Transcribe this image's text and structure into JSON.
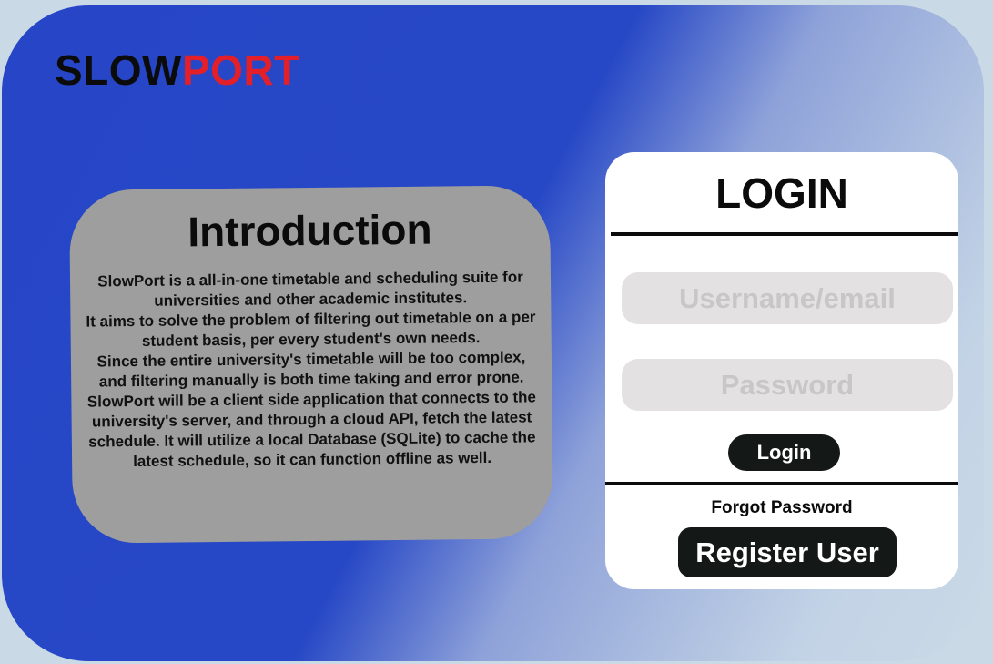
{
  "brand": {
    "part1": "SLOW",
    "part2": "PORT",
    "part1_color": "#0b0b0b",
    "part2_color": "#e3202a"
  },
  "intro": {
    "title": "Introduction",
    "paragraphs": [
      "SlowPort is a all-in-one timetable and scheduling suite for universities and other academic institutes.",
      "It aims to solve the problem of filtering out timetable on a per student basis, per every student's own needs.",
      "Since the entire university's timetable will be too complex, and filtering manually is both time taking and error prone.",
      "SlowPort will be a client side application that connects to the university's server, and through a cloud API, fetch the latest schedule. It will utilize a local Database (SQLite) to cache the latest schedule, so it can function offline as well."
    ]
  },
  "login": {
    "title": "LOGIN",
    "username_placeholder": "Username/email",
    "username_value": "",
    "password_placeholder": "Password",
    "password_value": "",
    "login_label": "Login",
    "forgot_label": "Forgot Password",
    "register_label": "Register User"
  },
  "colors": {
    "background_blue": "#2646c7",
    "panel_gray": "#9e9e9e",
    "button_dark": "#141917",
    "field_gray": "#e3e1e2"
  }
}
